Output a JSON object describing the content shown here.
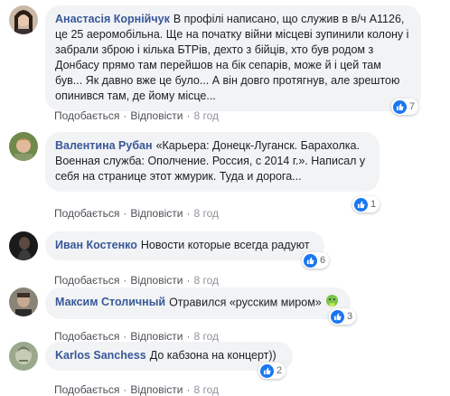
{
  "colors": {
    "author": "#385898",
    "bubble": "#f2f3f5",
    "like": "#1877f2"
  },
  "action_labels": {
    "like": "Подобається",
    "reply": "Відповісти",
    "separator": "·"
  },
  "comments": [
    {
      "author": "Анастасія Корнійчук",
      "text": "В профілі написано, що служив в в/ч А1126, це 25 аеромобільна. Ще на початку війни місцеві зупинили колону і забрали зброю і кілька БТРів, дехто з бійців, хто був родом з Донбасу прямо там перейшов на бік сепарів, може й і цей там був... Як давно вже це було... А він довго протягнув, але зрештою опинився там, де йому місце...",
      "time": "8 год",
      "reactions": {
        "icon": "like-icon",
        "count": "7"
      }
    },
    {
      "author": "Валентина Рубан",
      "text": "«Карьера: Донецк-Луганск. Барахолка. Военная служба: Ополчение. Россия, с 2014 г.». Написал у себя на странице этот жмурик. Туда и дорога...",
      "time": "8 год",
      "reactions": {
        "icon": "like-icon",
        "count": "1"
      }
    },
    {
      "author": "Иван Костенко",
      "text": "Новости которые всегда радуют",
      "time": "8 год",
      "reactions": {
        "icon": "like-icon",
        "count": "6"
      }
    },
    {
      "author": "Максим Столичный",
      "text": "Отравился «русским миром»",
      "emoji": "vomiting-face-emoji",
      "time": "8 год",
      "reactions": {
        "icon": "like-icon",
        "count": "3"
      }
    },
    {
      "author": "Karlos Sanchess",
      "text": "До кабзона на концерт))",
      "time": "8 год",
      "reactions": {
        "icon": "like-icon",
        "count": "2"
      }
    }
  ]
}
